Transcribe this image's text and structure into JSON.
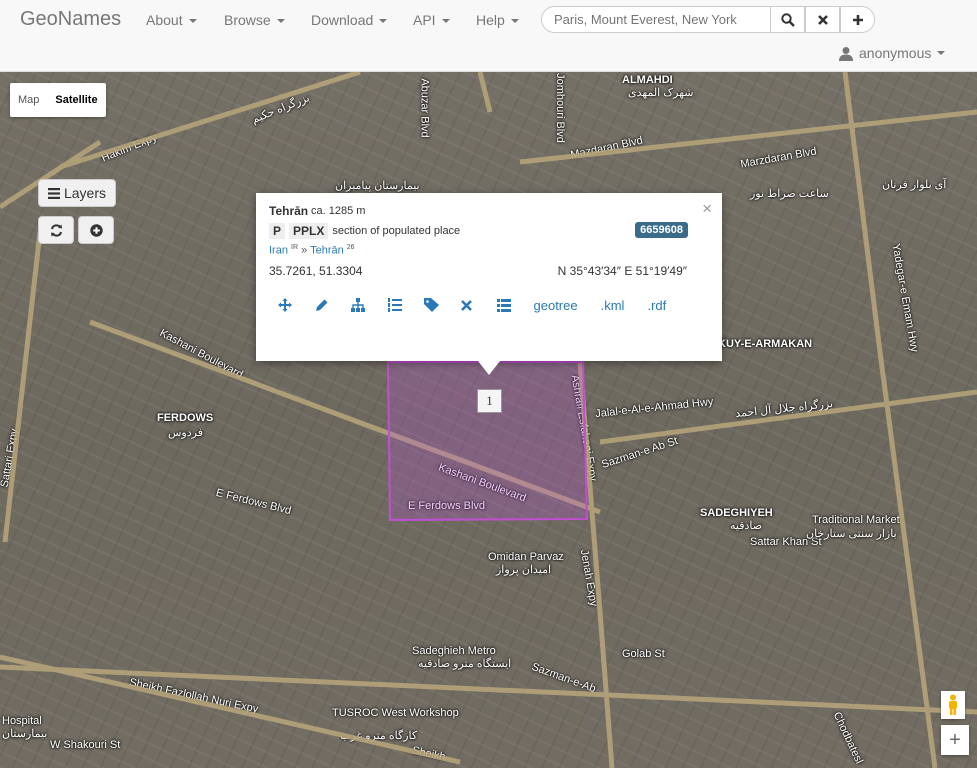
{
  "navbar": {
    "brand": "GeoNames",
    "menus": [
      "About",
      "Browse",
      "Download",
      "API",
      "Help"
    ],
    "search": {
      "placeholder": "Paris, Mount Everest, New York",
      "value": ""
    },
    "user": "anonymous"
  },
  "map_controls": {
    "map_type": {
      "map": "Map",
      "satellite": "Satellite",
      "selected": "Satellite"
    },
    "layers_label": "Layers",
    "zoom_in": "+"
  },
  "popup": {
    "name": "Tehrān",
    "elevation": "ca. 1285 m",
    "feature_class": "P",
    "feature_code": "PPLX",
    "feature_desc": "section of populated place",
    "geonameid": "6659608",
    "country": "Iran",
    "country_code": "IR",
    "admin1": "Tehrān",
    "admin1_code": "26",
    "sep": "»",
    "coords": "35.7261, 51.3304",
    "dms": "N 35°43′34″ E 51°19′49″",
    "close": "×",
    "links": [
      ".kml",
      ".rdf"
    ],
    "geotree": "geotree"
  },
  "marker": "1",
  "map_labels": [
    "ALMAHDI",
    "شهرک المهدی",
    "Mazdaran Blvd",
    "Marzdaran Blvd",
    "Hakim Expy",
    "بزرگراه حکیم",
    "Abuzar Blvd",
    "Jomhouri Blvd",
    "بیمارستان پیامبران",
    "Kashani Boulevard",
    "FERDOWS",
    "فردوس",
    "E Ferdows Blvd",
    "Sattari Expy",
    "Jalal-e-Al-e-Ahmad Hwy",
    "بزرگراه جلال آل احمد",
    "KUY-E-ARMAKAN",
    "Sazman-e Ab St",
    "SADEGHIYEH",
    "صادقیه",
    "Sattar Khan St",
    "Traditional Market",
    "بازار سنتی ستارخان",
    "Omidan Parvaz",
    "امیدان پرواز",
    "Sadeghieh Metro",
    "ایستگاه مترو صادقیه",
    "Golab St",
    "Sazman-e-Ab",
    "Sheikh Fazlollah Nuri Expy",
    "TUSROC West Workshop",
    "کارگاه مترو غرب",
    "W Shakouri St",
    "Jenah Expy",
    "Ashrafi Esfahani Expy",
    "Yadegar-e Emam Hwy",
    "Chodbatesl",
    "Hospital",
    "بیمارستان",
    "Sheikh",
    "ساعت صراط نور",
    "آی بلوار فرنان",
    "Kashani Boulevard",
    "E Ferdows Blvd"
  ],
  "colors": {
    "polygon": "#c04fd2",
    "id_badge": "#3a6b8a",
    "link": "#2a7ab8"
  }
}
